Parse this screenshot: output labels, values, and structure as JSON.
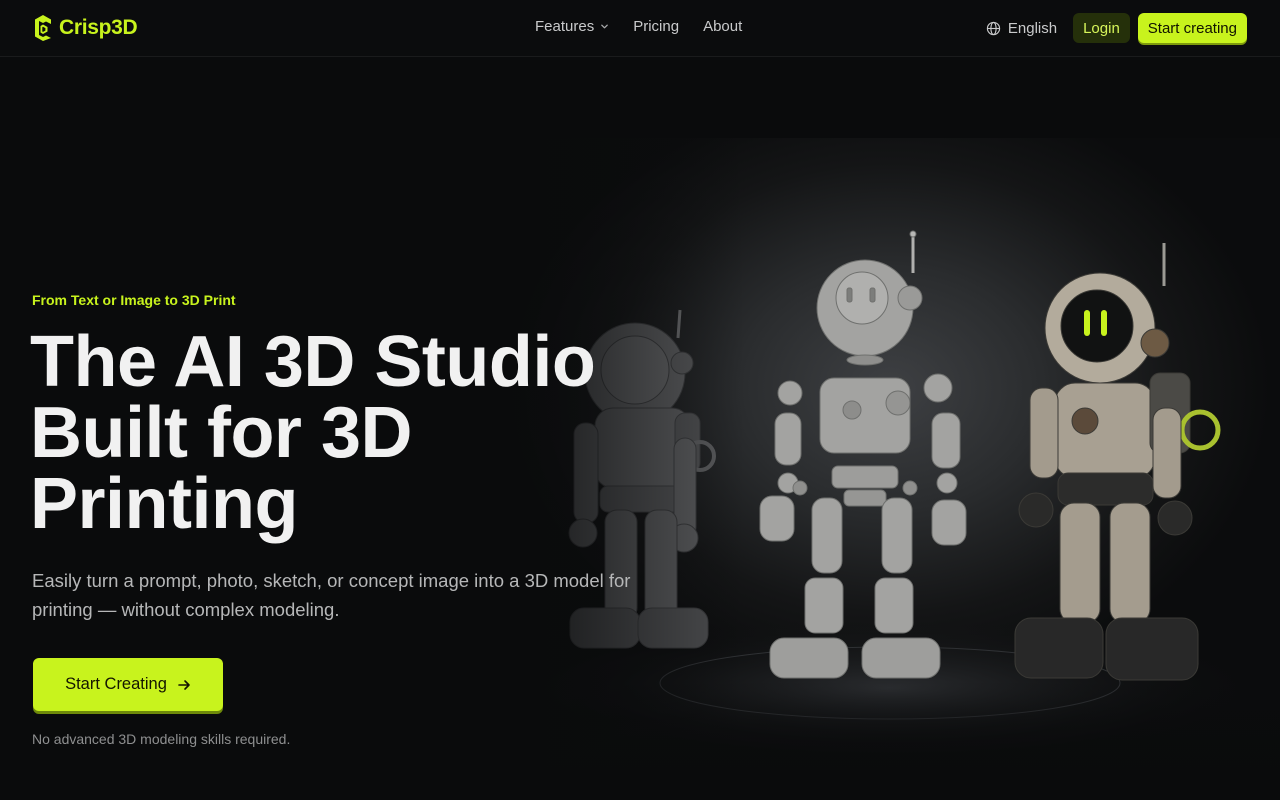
{
  "brand": {
    "name": "Crisp3D",
    "logo_icon": "crisp3d-logo-icon"
  },
  "nav": {
    "links": [
      {
        "label": "Features",
        "has_dropdown": true
      },
      {
        "label": "Pricing"
      },
      {
        "label": "About"
      }
    ],
    "language": {
      "label": "English",
      "icon": "globe-icon"
    },
    "login_label": "Login",
    "start_label": "Start creating"
  },
  "hero": {
    "eyebrow": "From Text or Image to 3D Print",
    "title_lines": [
      "The AI 3D Studio",
      "Built for 3D",
      "Printing"
    ],
    "subtitle": "Easily turn a prompt, photo, sketch, or concept image into a 3D model for printing — without complex modeling.",
    "cta_label": "Start Creating",
    "cta_icon": "arrow-right-icon",
    "note": "No advanced 3D modeling skills required."
  },
  "colors": {
    "accent": "#c8f31d",
    "background": "#0a0b0c",
    "login_bg": "#25300a"
  }
}
